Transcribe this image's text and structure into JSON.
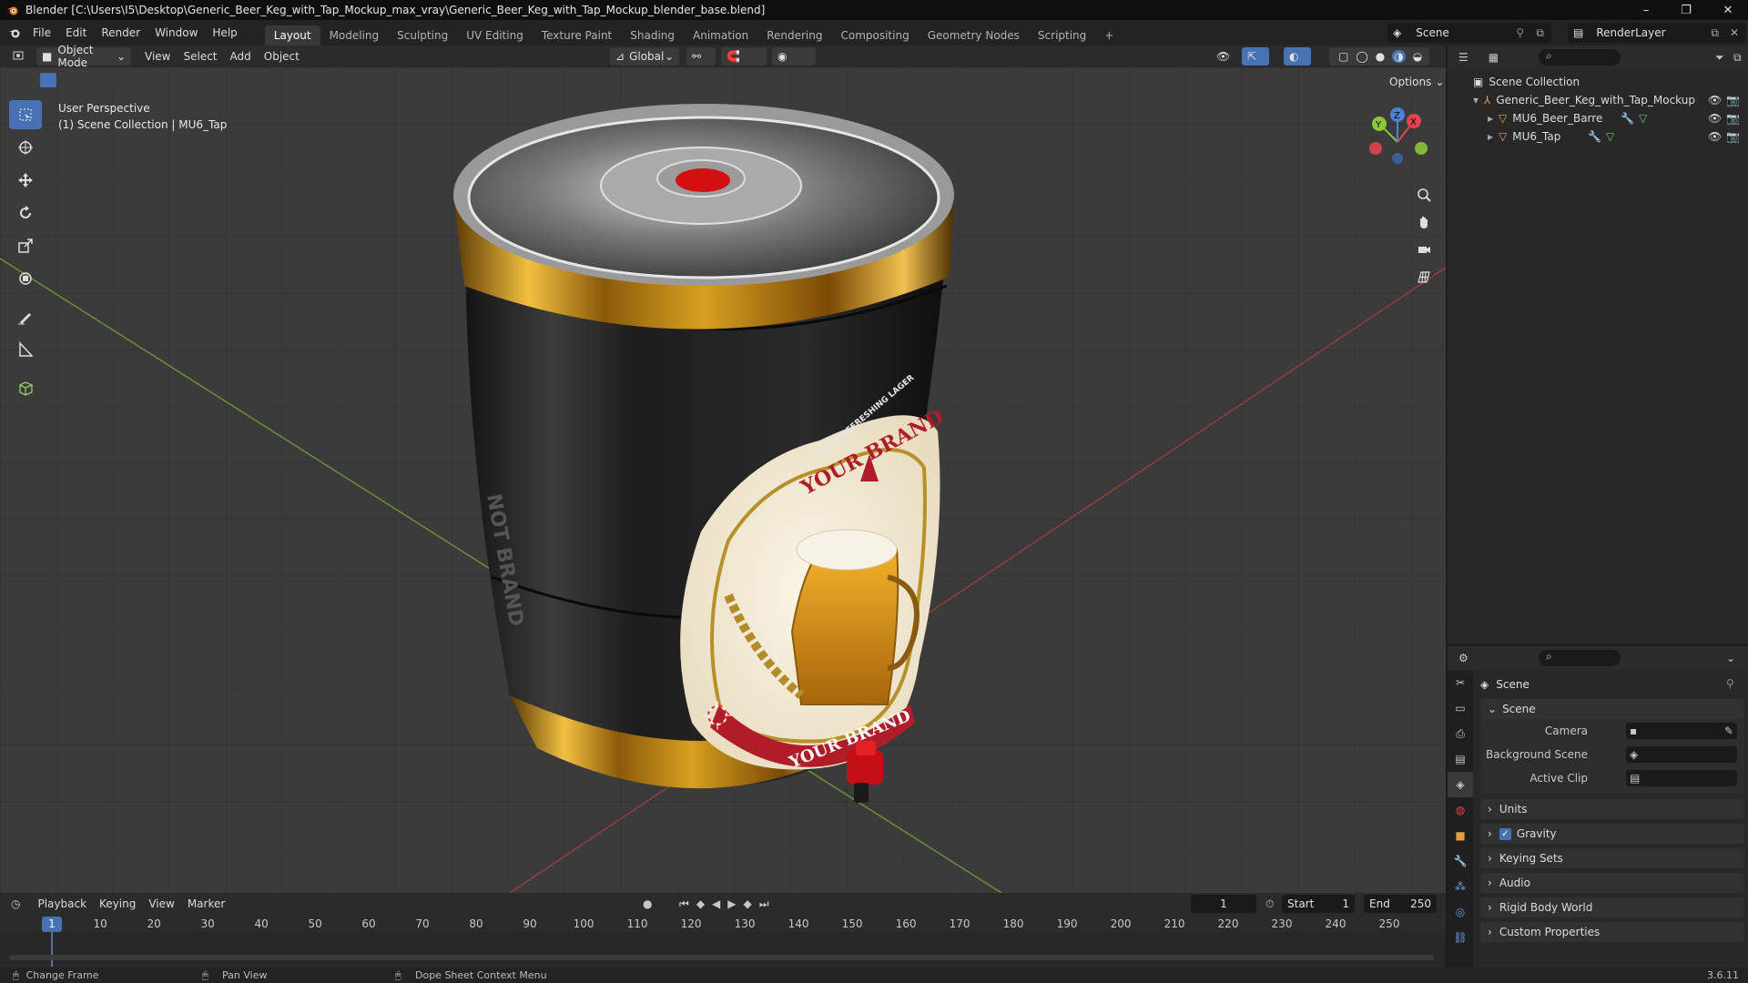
{
  "window": {
    "title": "Blender [C:\\Users\\I5\\Desktop\\Generic_Beer_Keg_with_Tap_Mockup_max_vray\\Generic_Beer_Keg_with_Tap_Mockup_blender_base.blend]",
    "minimize": "–",
    "maximize": "❐",
    "close": "✕"
  },
  "menu": [
    "File",
    "Edit",
    "Render",
    "Window",
    "Help"
  ],
  "workspaces": [
    "Layout",
    "Modeling",
    "Sculpting",
    "UV Editing",
    "Texture Paint",
    "Shading",
    "Animation",
    "Rendering",
    "Compositing",
    "Geometry Nodes",
    "Scripting",
    "+"
  ],
  "active_workspace": "Layout",
  "scene_name": "Scene",
  "view_layer": "RenderLayer",
  "viewport_header": {
    "mode": "Object Mode",
    "menus": [
      "View",
      "Select",
      "Add",
      "Object"
    ],
    "orientation": "Global",
    "options": "Options"
  },
  "viewport": {
    "view_name": "User Perspective",
    "collection_info": "(1) Scene Collection | MU6_Tap",
    "gizmo": {
      "x": "X",
      "y": "Y",
      "z": "Z"
    }
  },
  "keg_label": {
    "top_text": "BEST REFRESHING LAGER",
    "brand": "YOUR BRAND",
    "ribbon": "YOUR BRAND",
    "side_text": "NOT BRAND"
  },
  "outliner": {
    "root": "Scene Collection",
    "items": [
      {
        "label": "Generic_Beer_Keg_with_Tap_Mockup",
        "level": 1
      },
      {
        "label": "MU6_Beer_Barre",
        "level": 2
      },
      {
        "label": "MU6_Tap",
        "level": 2
      }
    ]
  },
  "properties": {
    "context": "Scene",
    "section": "Scene",
    "fields": [
      {
        "label": "Camera",
        "value": ""
      },
      {
        "label": "Background Scene",
        "value": ""
      },
      {
        "label": "Active Clip",
        "value": ""
      }
    ],
    "panels": [
      "Units",
      "Gravity",
      "Keying Sets",
      "Audio",
      "Rigid Body World",
      "Custom Properties"
    ],
    "gravity_checked": true
  },
  "timeline": {
    "menus": [
      "Playback",
      "Keying",
      "View",
      "Marker"
    ],
    "current_frame": "1",
    "start_label": "Start",
    "start": "1",
    "end_label": "End",
    "end": "250",
    "ticks": [
      "1",
      "10",
      "20",
      "30",
      "40",
      "50",
      "60",
      "70",
      "80",
      "90",
      "100",
      "110",
      "120",
      "130",
      "140",
      "150",
      "160",
      "170",
      "180",
      "190",
      "200",
      "210",
      "220",
      "230",
      "240",
      "250"
    ]
  },
  "statusbar": {
    "items": [
      "Change Frame",
      "Pan View",
      "Dope Sheet Context Menu"
    ],
    "version": "3.6.11"
  },
  "colors": {
    "accent": "#4772b3",
    "x_axis": "#e2434c",
    "y_axis": "#8cc63a",
    "z_axis": "#4a82d8"
  }
}
